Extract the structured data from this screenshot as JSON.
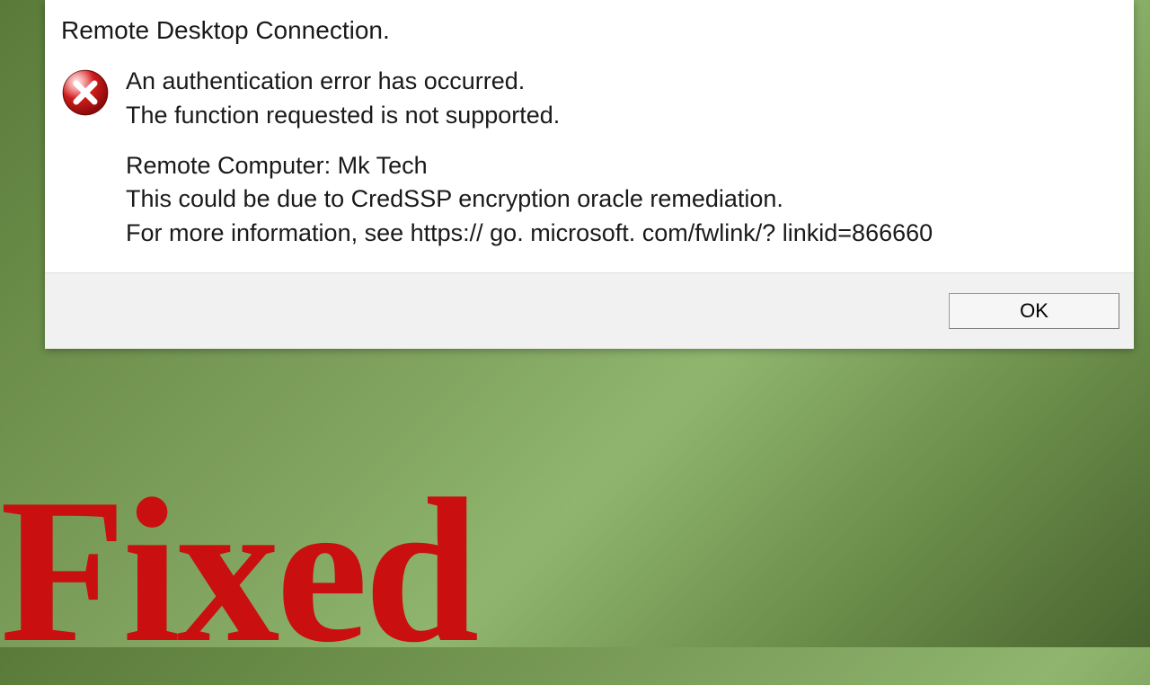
{
  "dialog": {
    "title": "Remote Desktop Connection.",
    "message": {
      "line1": "An authentication error has occurred.",
      "line2": "The function requested is not supported.",
      "line3": "Remote Computer: Mk Tech",
      "line4": "This could be due to CredSSP encryption oracle remediation.",
      "line5": "For more information, see https:// go. microsoft. com/fwlink/? linkid=866660"
    },
    "ok_label": "OK"
  },
  "overlay": {
    "text": "Fixed"
  },
  "icons": {
    "error": "error-icon"
  },
  "colors": {
    "overlay_red": "#c90f0f",
    "footer_bg": "#f1f1f1"
  }
}
